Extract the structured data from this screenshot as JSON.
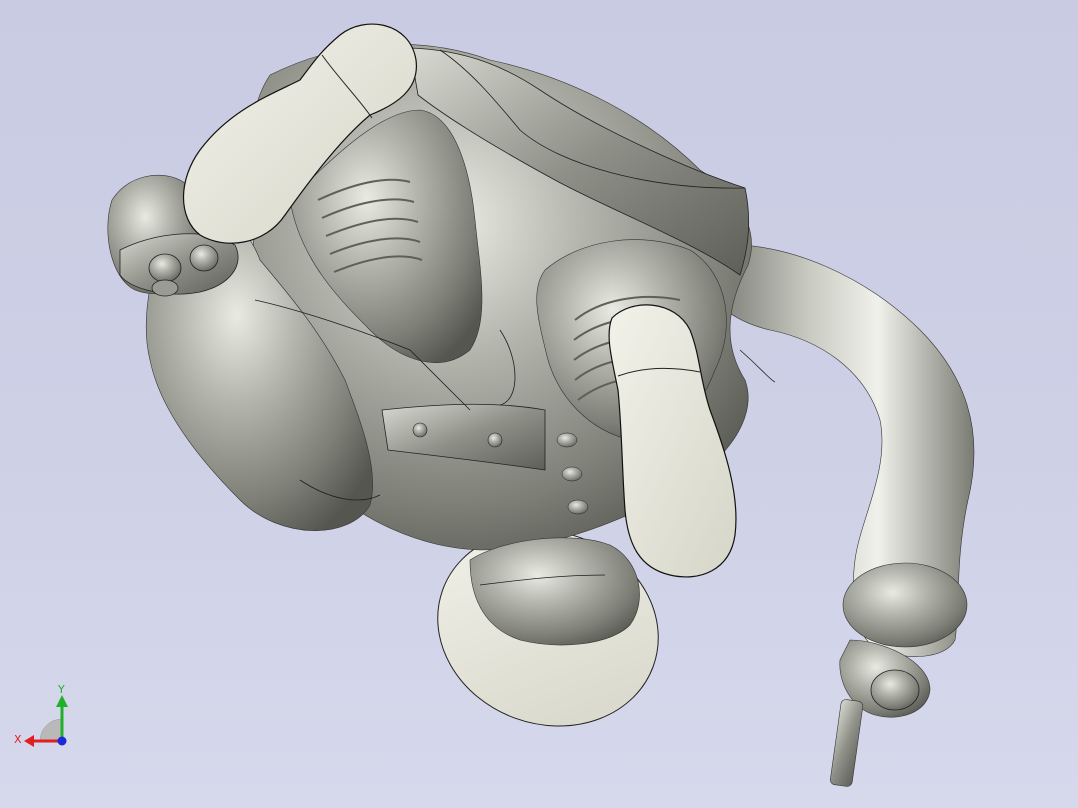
{
  "viewport": {
    "background_top": "#c9cbe3",
    "background_bottom": "#d6d8ec"
  },
  "model": {
    "metal_color": "#8d8e86",
    "metal_highlight": "#e9eae2",
    "face_color": "#e3e3d6",
    "edge_color": "#1e1e1e"
  },
  "triad": {
    "x_label": "X",
    "y_label": "Y",
    "x_color": "#e01f1f",
    "y_color": "#22b02a",
    "z_color": "#1c2ad6"
  }
}
